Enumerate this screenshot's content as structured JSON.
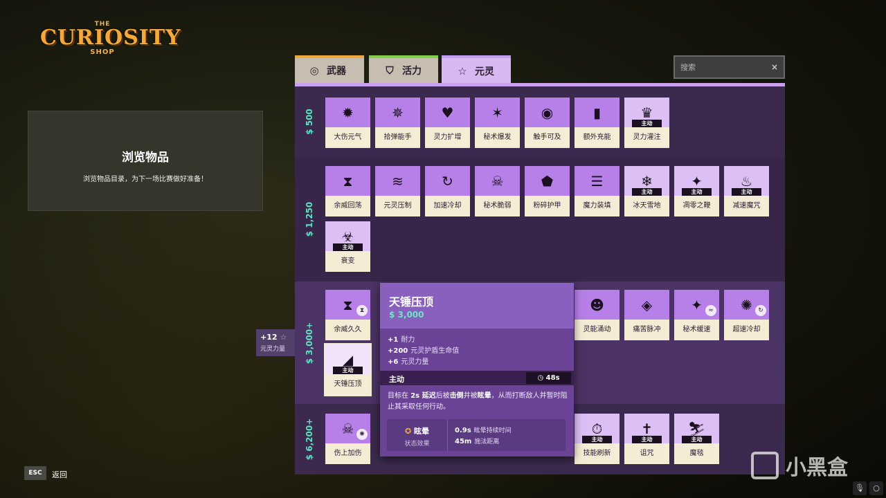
{
  "logo": {
    "the": "THE",
    "main": "CURIOSITY",
    "shop": "SHOP"
  },
  "browse": {
    "title": "浏览物品",
    "subtitle": "浏览物品目录，为下一场比赛做好准备！"
  },
  "tabs": [
    {
      "label": "武器",
      "icon": "weapon-target-icon"
    },
    {
      "label": "活力",
      "icon": "vitality-shield-icon"
    },
    {
      "label": "元灵",
      "icon": "spirit-star-icon"
    }
  ],
  "search": {
    "placeholder": "搜索",
    "clear": "×"
  },
  "tiers": [
    {
      "price": "500",
      "items": [
        {
          "name": "大伤元气",
          "icon": "✹"
        },
        {
          "name": "拾弹能手",
          "icon": "✵"
        },
        {
          "name": "灵力扩增",
          "icon": "♥"
        },
        {
          "name": "秘术爆发",
          "icon": "✶"
        },
        {
          "name": "触手可及",
          "icon": "◉"
        },
        {
          "name": "额外充能",
          "icon": "▮"
        },
        {
          "name": "灵力灌注",
          "icon": "♛",
          "active": "主动"
        }
      ]
    },
    {
      "price": "1,250",
      "items": [
        {
          "name": "余威回荡",
          "icon": "⧗"
        },
        {
          "name": "元灵压制",
          "icon": "≋"
        },
        {
          "name": "加速冷却",
          "icon": "↻"
        },
        {
          "name": "秘术脆弱",
          "icon": "☠"
        },
        {
          "name": "粉碎护甲",
          "icon": "⬟"
        },
        {
          "name": "魔力装填",
          "icon": "☰"
        },
        {
          "name": "冰天雪地",
          "icon": "❄",
          "active": "主动"
        },
        {
          "name": "凋零之鞭",
          "icon": "✦",
          "active": "主动"
        },
        {
          "name": "减速魔咒",
          "icon": "♨",
          "active": "主动"
        },
        {
          "name": "衰变",
          "icon": "☣",
          "active": "主动"
        }
      ]
    },
    {
      "price": "3,000+",
      "items": [
        {
          "name": "余威久久",
          "icon": "⧗",
          "badge": "⧗"
        },
        {
          "name": "灵能涌动",
          "icon": "☻"
        },
        {
          "name": "痛苦脉冲",
          "icon": "◈"
        },
        {
          "name": "秘术缓速",
          "icon": "✦",
          "badge": "≈"
        },
        {
          "name": "超速冷却",
          "icon": "✺",
          "badge": "↻"
        },
        {
          "name": "天锤压顶",
          "icon": "◢",
          "active": "主动"
        }
      ]
    },
    {
      "price": "6,200+",
      "items": [
        {
          "name": "伤上加伤",
          "icon": "☠",
          "badge": "✺"
        },
        {
          "name": "技能刷新",
          "icon": "⏱",
          "active": "主动"
        },
        {
          "name": "诅咒",
          "icon": "✝",
          "active": "主动"
        },
        {
          "name": "魔毯",
          "icon": "⛷",
          "active": "主动"
        }
      ]
    }
  ],
  "spirit_power": {
    "value": "+12",
    "star": "☆",
    "label": "元灵力量"
  },
  "tooltip": {
    "name": "天锤压顶",
    "price": "3,000",
    "currency_icon": "souls-icon",
    "stats": [
      {
        "value": "+1",
        "label": "耐力"
      },
      {
        "value": "+200",
        "label": "元灵护盾生命值"
      },
      {
        "value": "+6",
        "label": "元灵力量"
      }
    ],
    "active_label": "主动",
    "cooldown": "48s",
    "desc": {
      "p1": "目标在 ",
      "b1": "2s 延迟",
      "p2": "后被",
      "b2": "击倒",
      "p3": "并被",
      "b3": "眩晕",
      "p4": "，从而打断敌人并暂时阻止其采取任何行动。"
    },
    "effect": {
      "name": "眩晕",
      "type": "状态效果",
      "duration_value": "0.9s",
      "duration_label": "眩晕持续时间",
      "range_value": "45m",
      "range_label": "施法距离"
    }
  },
  "footer": {
    "esc": "ESC",
    "back": "返回"
  },
  "watermark": {
    "text": "小黑盒"
  }
}
